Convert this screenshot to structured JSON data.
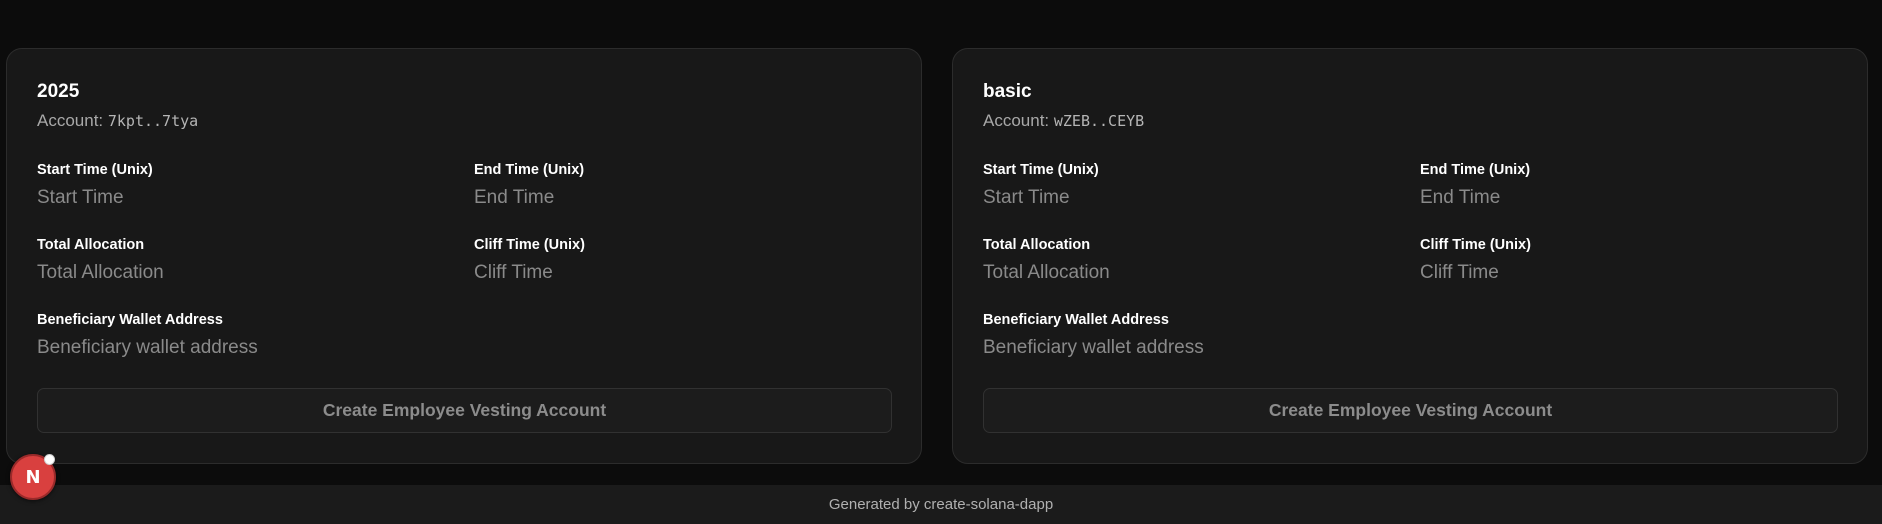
{
  "cards": [
    {
      "title": "2025",
      "account_label": "Account: ",
      "account_value": "7kpt..7tya",
      "fields": {
        "start_time": {
          "label": "Start Time (Unix)",
          "placeholder": "Start Time",
          "value": ""
        },
        "end_time": {
          "label": "End Time (Unix)",
          "placeholder": "End Time",
          "value": ""
        },
        "total_allocation": {
          "label": "Total Allocation",
          "placeholder": "Total Allocation",
          "value": ""
        },
        "cliff_time": {
          "label": "Cliff Time (Unix)",
          "placeholder": "Cliff Time",
          "value": ""
        },
        "beneficiary": {
          "label": "Beneficiary Wallet Address",
          "placeholder": "Beneficiary wallet address",
          "value": ""
        }
      },
      "submit_label": "Create Employee Vesting Account"
    },
    {
      "title": "basic",
      "account_label": "Account: ",
      "account_value": "wZEB..CEYB",
      "fields": {
        "start_time": {
          "label": "Start Time (Unix)",
          "placeholder": "Start Time",
          "value": ""
        },
        "end_time": {
          "label": "End Time (Unix)",
          "placeholder": "End Time",
          "value": ""
        },
        "total_allocation": {
          "label": "Total Allocation",
          "placeholder": "Total Allocation",
          "value": ""
        },
        "cliff_time": {
          "label": "Cliff Time (Unix)",
          "placeholder": "Cliff Time",
          "value": ""
        },
        "beneficiary": {
          "label": "Beneficiary Wallet Address",
          "placeholder": "Beneficiary wallet address",
          "value": ""
        }
      },
      "submit_label": "Create Employee Vesting Account"
    }
  ],
  "footer": {
    "text": "Generated by create-solana-dapp"
  },
  "dev_badge": {
    "letter": "N",
    "icon": "nextjs-dev-indicator-icon",
    "color": "#d9403f"
  },
  "colors": {
    "background": "#0c0c0c",
    "card": "#181818",
    "footer": "#1b1b1b"
  }
}
